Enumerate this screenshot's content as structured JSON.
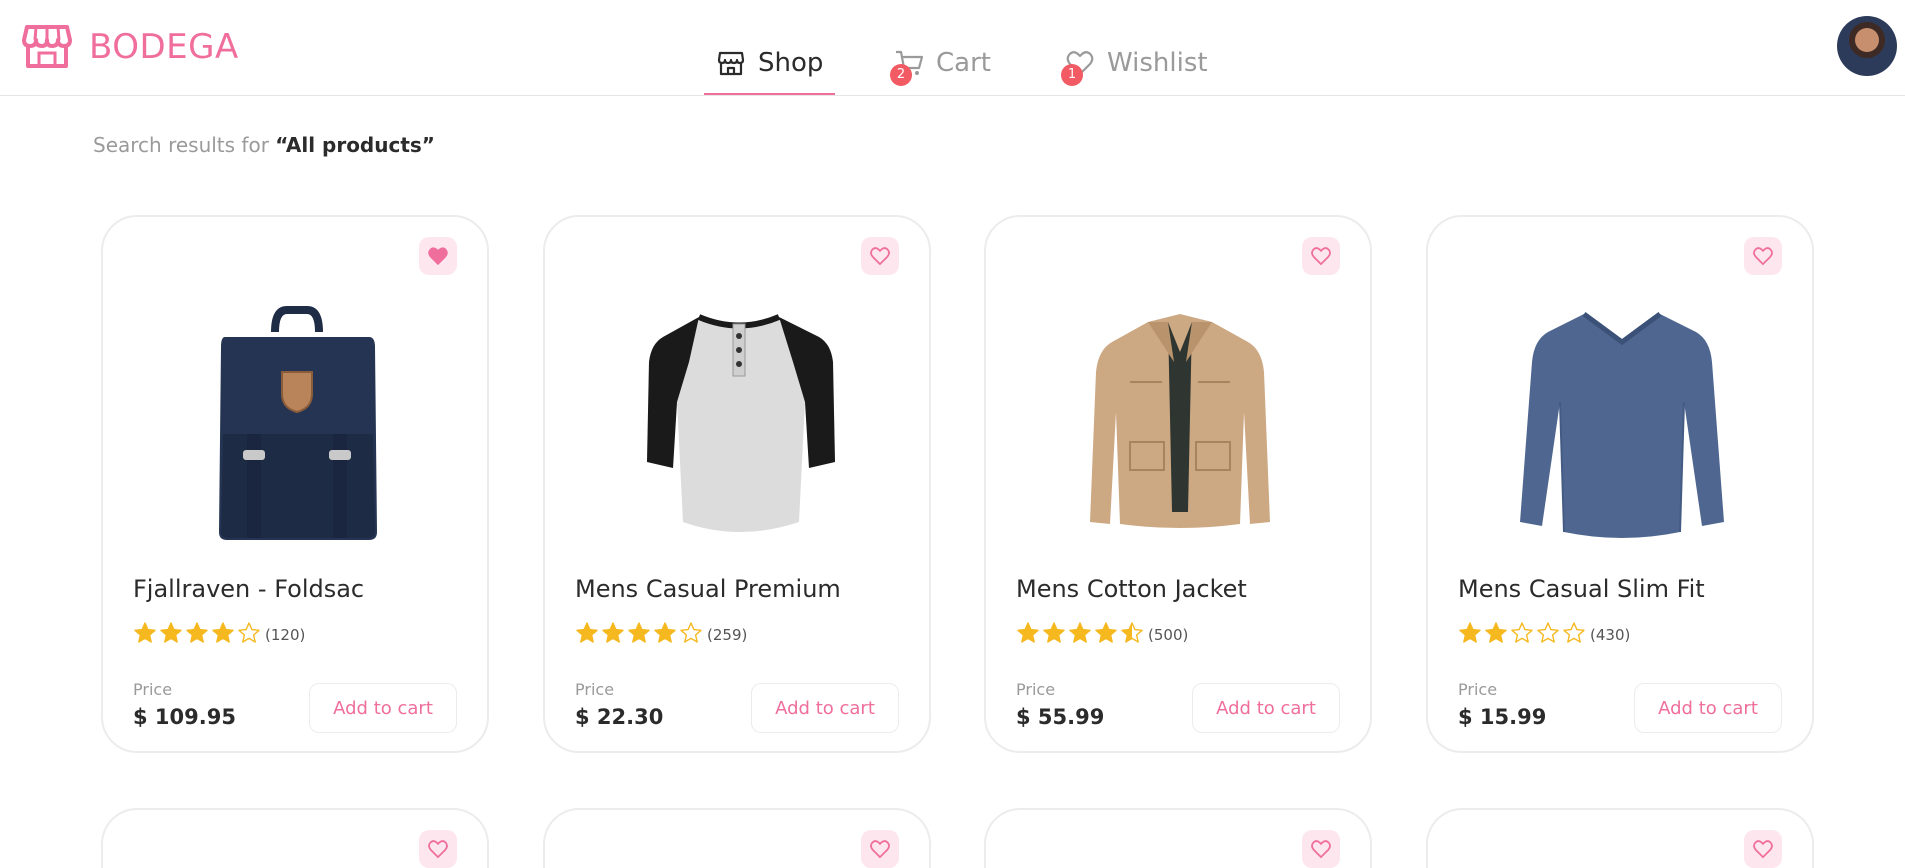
{
  "brand": {
    "name": "BODEGA",
    "color": "#f06e9c",
    "icon": "storefront-icon"
  },
  "nav": {
    "tabs": [
      {
        "label": "Shop",
        "icon": "store-icon",
        "active": true
      },
      {
        "label": "Cart",
        "icon": "cart-icon",
        "badge": "2",
        "active": false
      },
      {
        "label": "Wishlist",
        "icon": "heart-outline-icon",
        "badge": "1",
        "active": false
      }
    ]
  },
  "user": {
    "avatar": "avatar"
  },
  "search": {
    "prefix": "Search results for",
    "query": "“All products”"
  },
  "products": [
    {
      "name": "Fjallraven - Foldsac",
      "rating": 4,
      "reviews": "(120)",
      "price_label": "Price",
      "price": "$ 109.95",
      "cta": "Add to cart",
      "wishlisted": true,
      "image": "backpack-image"
    },
    {
      "name": "Mens Casual Premium",
      "rating": 4,
      "reviews": "(259)",
      "price_label": "Price",
      "price": "$ 22.30",
      "cta": "Add to cart",
      "wishlisted": false,
      "image": "raglan-tshirt-image"
    },
    {
      "name": "Mens Cotton Jacket",
      "rating": 4.5,
      "reviews": "(500)",
      "price_label": "Price",
      "price": "$ 55.99",
      "cta": "Add to cart",
      "wishlisted": false,
      "image": "jacket-image"
    },
    {
      "name": "Mens Casual Slim Fit",
      "rating": 2,
      "reviews": "(430)",
      "price_label": "Price",
      "price": "$ 15.99",
      "cta": "Add to cart",
      "wishlisted": false,
      "image": "longsleeve-shirt-image"
    }
  ],
  "colors": {
    "accent": "#f06e9c",
    "star": "#f6b81f",
    "badge": "#f25a64",
    "wish_bg": "#fde6ee"
  }
}
